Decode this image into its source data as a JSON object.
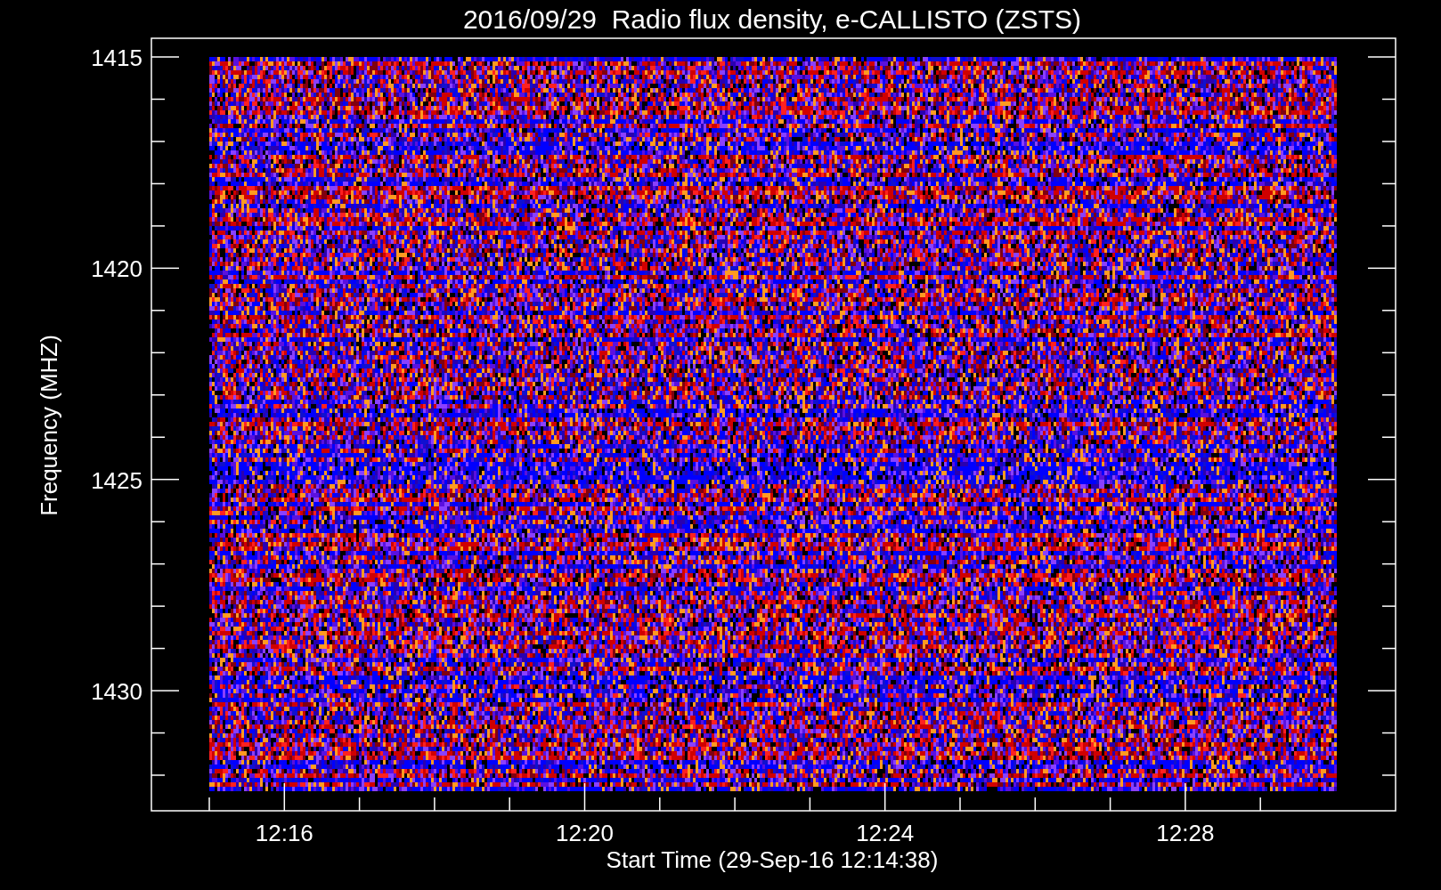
{
  "plot": {
    "title": "2016/09/29  Radio flux density, e-CALLISTO (ZSTS)",
    "y_axis": {
      "label": "Frequency (MHZ)",
      "ticks": [
        "1415",
        "1420",
        "1425",
        "1430"
      ]
    },
    "x_axis": {
      "label": "Start Time (29-Sep-16 12:14:38)",
      "ticks": [
        "12:16",
        "12:20",
        "12:24",
        "12:28"
      ]
    }
  }
}
